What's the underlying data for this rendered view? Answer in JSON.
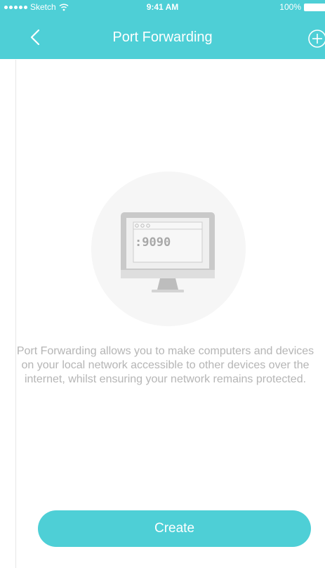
{
  "status_bar": {
    "carrier": "Sketch",
    "time": "9:41 AM",
    "battery": "100%"
  },
  "nav": {
    "title": "Port Forwarding",
    "back_icon": "chevron-left-icon",
    "add_icon": "plus-circle-icon"
  },
  "illustration": {
    "port_text": ":9090"
  },
  "empty_state": {
    "description": "Port Forwarding allows you to make computers and devices on your local network accessible to other devices over the internet, whilst ensuring your network remains protected."
  },
  "actions": {
    "create_label": "Create"
  },
  "colors": {
    "accent": "#4ecfd6",
    "description_text": "#b5b5b5"
  }
}
